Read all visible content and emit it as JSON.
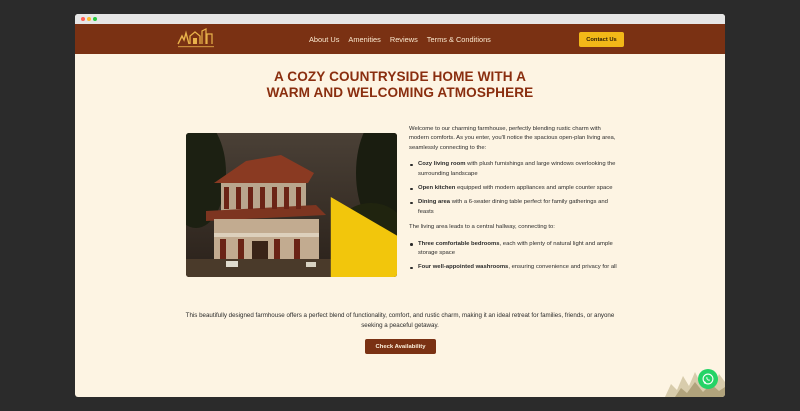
{
  "nav": {
    "links": [
      "About Us",
      "Amenities",
      "Reviews",
      "Terms & Conditions"
    ],
    "contact_label": "Contact Us"
  },
  "hero": {
    "title_line1": "A COZY COUNTRYSIDE HOME WITH A",
    "title_line2": "WARM AND WELCOMING ATMOSPHERE"
  },
  "intro": "Welcome to our charming farmhouse, perfectly blending rustic charm with modern comforts. As you enter, you'll notice the spacious open-plan living area, seamlessly connecting to the:",
  "features": [
    {
      "title": "Cozy living room",
      "text": " with plush furnishings and large windows overlooking the surrounding landscape"
    },
    {
      "title": "Open kitchen",
      "text": " equipped with modern appliances and ample counter space"
    },
    {
      "title": "Dining area",
      "text": " with a 6-seater dining table perfect for family gatherings and feasts"
    }
  ],
  "hallway": "The living area leads to a central hallway, connecting to:",
  "rooms": [
    {
      "title": "Three comfortable bedrooms",
      "text": ", each with plenty of natural light and ample storage space"
    },
    {
      "title": "Four well-appointed washrooms",
      "text": ", ensuring convenience and privacy for all"
    }
  ],
  "summary": "This beautifully designed farmhouse offers a perfect blend of functionality, comfort, and rustic charm, making it an ideal retreat for families, friends, or anyone seeking a peaceful getaway.",
  "cta_label": "Check Availability",
  "icons": {
    "play": "play-icon",
    "whatsapp": "whatsapp-icon",
    "logo": "logo-icon"
  },
  "colors": {
    "nav_bg": "#7a3113",
    "accent": "#f2b818",
    "page_bg": "#fdf4e3",
    "title": "#8a2e0f"
  }
}
